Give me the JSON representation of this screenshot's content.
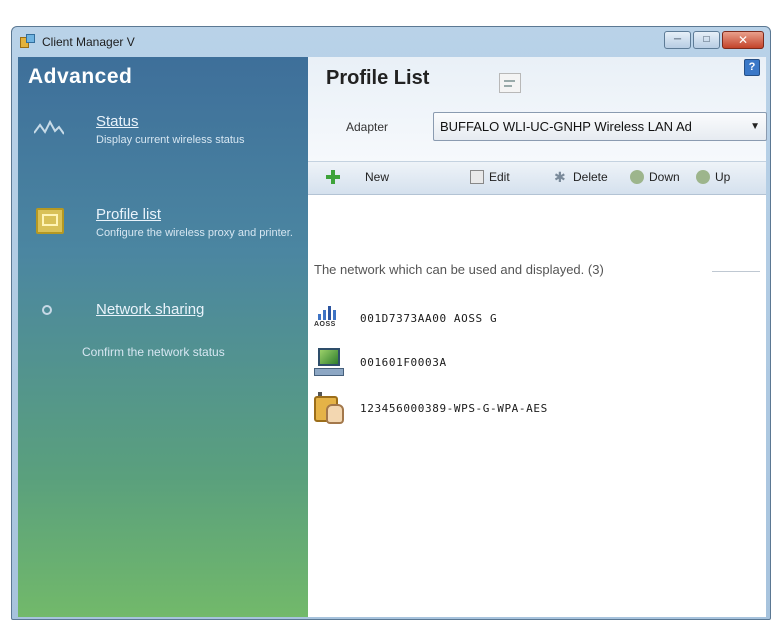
{
  "window": {
    "title": "Client Manager V",
    "controls": [
      "minimize-icon",
      "maximize-icon",
      "close-icon"
    ]
  },
  "sidebar": {
    "heading": "Advanced",
    "items": [
      {
        "icon": "status-icon",
        "label": "Status",
        "description": "Display current wireless status"
      },
      {
        "icon": "profile-list-icon",
        "label": "Profile list",
        "description": "Configure the wireless proxy and printer."
      },
      {
        "icon": "network-sharing-icon",
        "label": "Network sharing",
        "description": "Confirm the network status"
      }
    ]
  },
  "main": {
    "title": "Profile List",
    "help_icon": "help-icon",
    "adapter_label": "Adapter",
    "adapter_value": "BUFFALO WLI-UC-GNHP Wireless LAN Ad",
    "toolbar": {
      "new": "New",
      "edit": "Edit",
      "delete": "Delete",
      "down": "Down",
      "up": "Up"
    },
    "section_heading": "The network which can be used and displayed. (3)",
    "networks": [
      {
        "icon": "aoss-icon",
        "icon_text": "AOSS",
        "label": "001D7373AA00 AOSS G"
      },
      {
        "icon": "computer-icon",
        "label": "001601F0003A"
      },
      {
        "icon": "wps-icon",
        "label": "123456000389-WPS-G-WPA-AES"
      }
    ]
  },
  "colors": {
    "sidebar_top": "#3e6f9a",
    "sidebar_bottom": "#72b96a",
    "frame": "#b9d2e8",
    "toolbar": "#d5e1ee"
  }
}
